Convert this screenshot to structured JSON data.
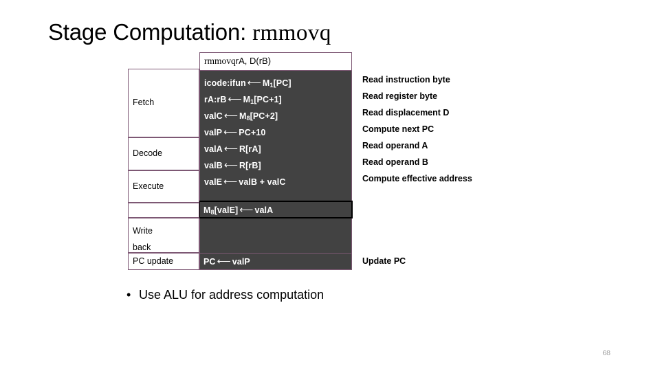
{
  "slide": {
    "title_prefix": "Stage Computation: ",
    "title_instruction": "rmmovq",
    "page_number": "68"
  },
  "table": {
    "header": {
      "instruction": "rmmovq",
      "operands": " rA, D(rB)"
    },
    "stage_labels": {
      "fetch": "Fetch",
      "decode": "Decode",
      "execute": "Execute",
      "memory": "",
      "writeback_line1": "Write",
      "writeback_line2": "back",
      "pcupdate": "PC update"
    },
    "operations": {
      "fetch": [
        {
          "lhs": "icode:ifun",
          "arrow": "⟵",
          "rhs_pre": "M",
          "rhs_sub": "1",
          "rhs_post": "[PC]"
        },
        {
          "lhs": "rA:rB",
          "arrow": "⟵",
          "rhs_pre": "M",
          "rhs_sub": "1",
          "rhs_post": "[PC+1]"
        },
        {
          "lhs": "valC",
          "arrow": "⟵",
          "rhs_pre": "M",
          "rhs_sub": "8",
          "rhs_post": "[PC+2]"
        },
        {
          "lhs": "valP",
          "arrow": "⟵",
          "rhs_pre": "PC+10",
          "rhs_sub": "",
          "rhs_post": ""
        }
      ],
      "decode": [
        {
          "lhs": "valA",
          "arrow": "⟵",
          "rhs_pre": "R[rA]",
          "rhs_sub": "",
          "rhs_post": ""
        },
        {
          "lhs": "valB",
          "arrow": "⟵",
          "rhs_pre": "R[rB]",
          "rhs_sub": "",
          "rhs_post": ""
        }
      ],
      "execute": [
        {
          "lhs": "valE",
          "arrow": "⟵",
          "rhs_pre": "valB + valC",
          "rhs_sub": "",
          "rhs_post": ""
        }
      ],
      "memory": {
        "lhs_pre": "M",
        "lhs_sub": "8",
        "lhs_post": "[valE]",
        "arrow": "⟵",
        "rhs": "valA"
      },
      "pcupdate": {
        "lhs": "PC",
        "arrow": "⟵",
        "rhs": "valP"
      }
    }
  },
  "annotations": [
    "Read instruction byte",
    "Read register byte",
    "Read displacement D",
    "Compute next PC",
    "Read operand A",
    "Read operand B",
    "Compute effective address",
    "Update PC"
  ],
  "bullet": {
    "marker": "•",
    "text": "Use ALU for address computation"
  },
  "colors": {
    "table_border": "#7d5874",
    "cell_dark": "#424242",
    "highlight_border": "#000000",
    "page_number": "#a6a6a6"
  }
}
